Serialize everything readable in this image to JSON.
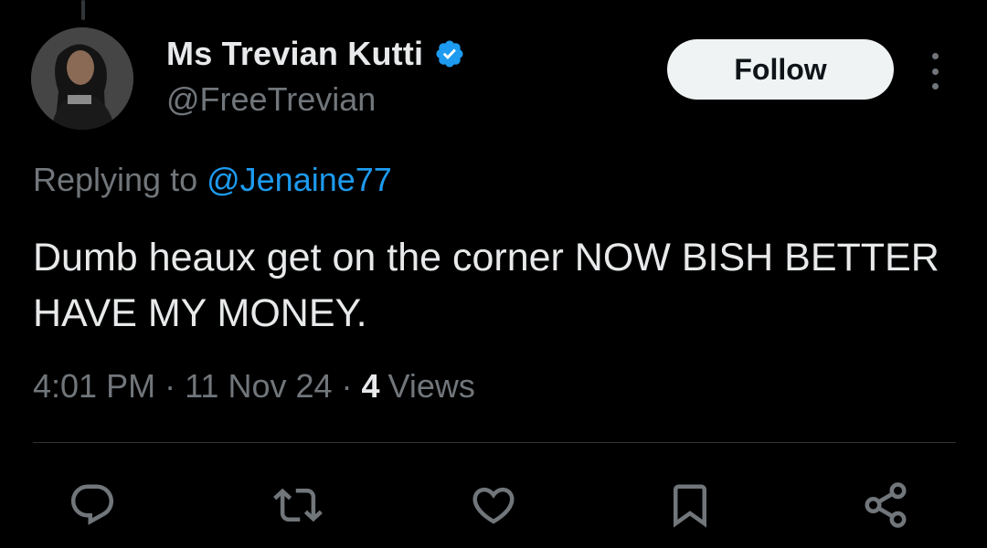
{
  "author": {
    "display_name": "Ms Trevian Kutti",
    "handle": "@FreeTrevian",
    "verified": true
  },
  "follow_label": "Follow",
  "replying_to": {
    "prefix": "Replying to ",
    "mention": "@Jenaine77"
  },
  "tweet": {
    "text": "Dumb heaux get on the corner NOW BISH BETTER HAVE MY MONEY."
  },
  "meta": {
    "time": "4:01 PM",
    "date": "11 Nov 24",
    "separator": "·",
    "views_count": "4",
    "views_label": "Views"
  },
  "actions": [
    "reply-icon",
    "retweet-icon",
    "like-icon",
    "bookmark-icon",
    "share-icon"
  ],
  "colors": {
    "background": "#000000",
    "text_primary": "#e7e9ea",
    "text_secondary": "#71767b",
    "accent": "#1d9bf0",
    "follow_bg": "#eff3f4",
    "divider": "#2f3336"
  }
}
